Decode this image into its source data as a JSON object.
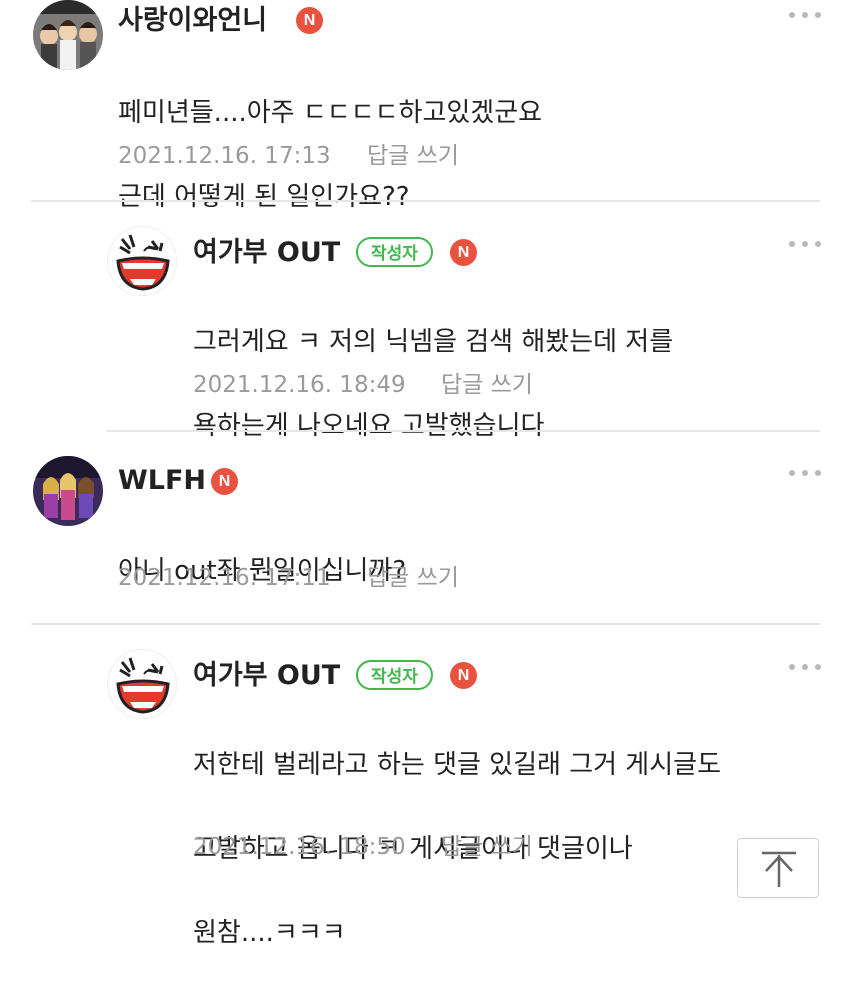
{
  "comments": [
    {
      "nickname": "사랑이와언니",
      "badge": "N",
      "line1": "페미년들....아주 ㄷㄷㄷㄷ하고있겠군요",
      "line2": "근데 어떻게 된 일인가요??",
      "date": "2021.12.16. 17:13",
      "reply": "답글 쓰기"
    },
    {
      "nickname": "여가부 OUT",
      "author_badge": "작성자",
      "badge": "N",
      "line1": "그러게요 ㅋ 저의 닉넴을 검색 해봤는데 저를",
      "line2": "욕하는게 나오네요 고발했습니다",
      "date": "2021.12.16. 18:49",
      "reply": "답글 쓰기"
    },
    {
      "nickname": "WLFH",
      "badge": "N",
      "line1": "아니 out좌 뭔일이십니까?",
      "date": "2021.12.16. 17:11",
      "reply": "답글 쓰기"
    },
    {
      "nickname": "여가부 OUT",
      "author_badge": "작성자",
      "badge": "N",
      "line1": "저한테 벌레라고 하는 댓글 있길래 그거 게시글도",
      "line2": "고발하고 옵니다 ㅋ 게시글이나 댓글이나",
      "line3": "원참....ㅋㅋㅋ",
      "date": "2021.12.16. 18:50",
      "reply": "답글 쓰기"
    }
  ],
  "colors": {
    "badge_n": "#e8523f",
    "author_badge": "#3fb84d",
    "meta_text": "#9a9a9a"
  },
  "icons": [
    "more-options-icon",
    "scroll-top-arrow-icon"
  ]
}
